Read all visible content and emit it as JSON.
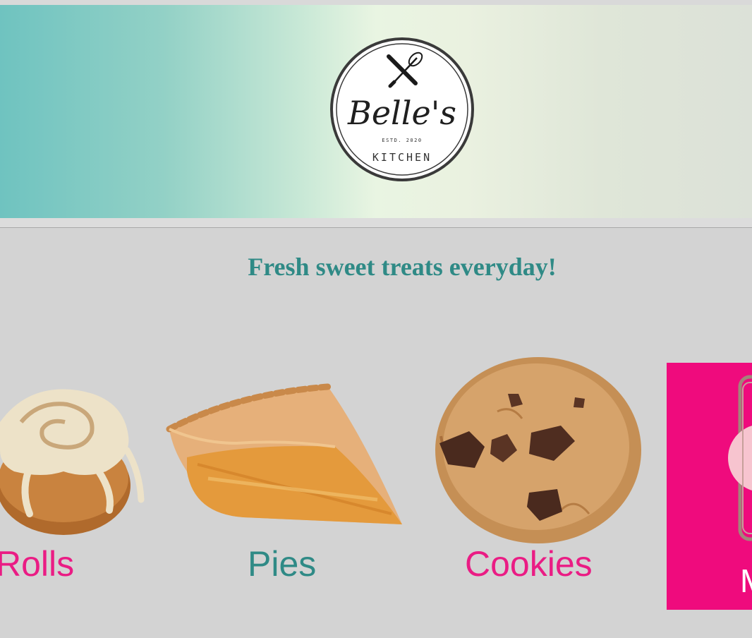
{
  "header": {
    "logo": {
      "brand_name": "Belle's",
      "established": "ESTD. 2020",
      "subtitle": "KITCHEN",
      "icon": "whisk-and-rolling-pin-icon"
    }
  },
  "main": {
    "tagline": "Fresh sweet treats everyday!",
    "products": [
      {
        "label": "Rolls",
        "image": "cinnamon-roll-image",
        "label_color": "#ea1c84"
      },
      {
        "label": "Pies",
        "image": "apple-pie-slice-image",
        "label_color": "#2f8a86"
      },
      {
        "label": "Cookies",
        "image": "chocolate-chip-cookie-image",
        "label_color": "#ea1c84"
      }
    ],
    "promo_card": {
      "label": "M",
      "background": "#ef0b7d"
    }
  },
  "colors": {
    "teal": "#2f8a86",
    "pink": "#ea1c84",
    "content_background": "#d3d3d3"
  }
}
